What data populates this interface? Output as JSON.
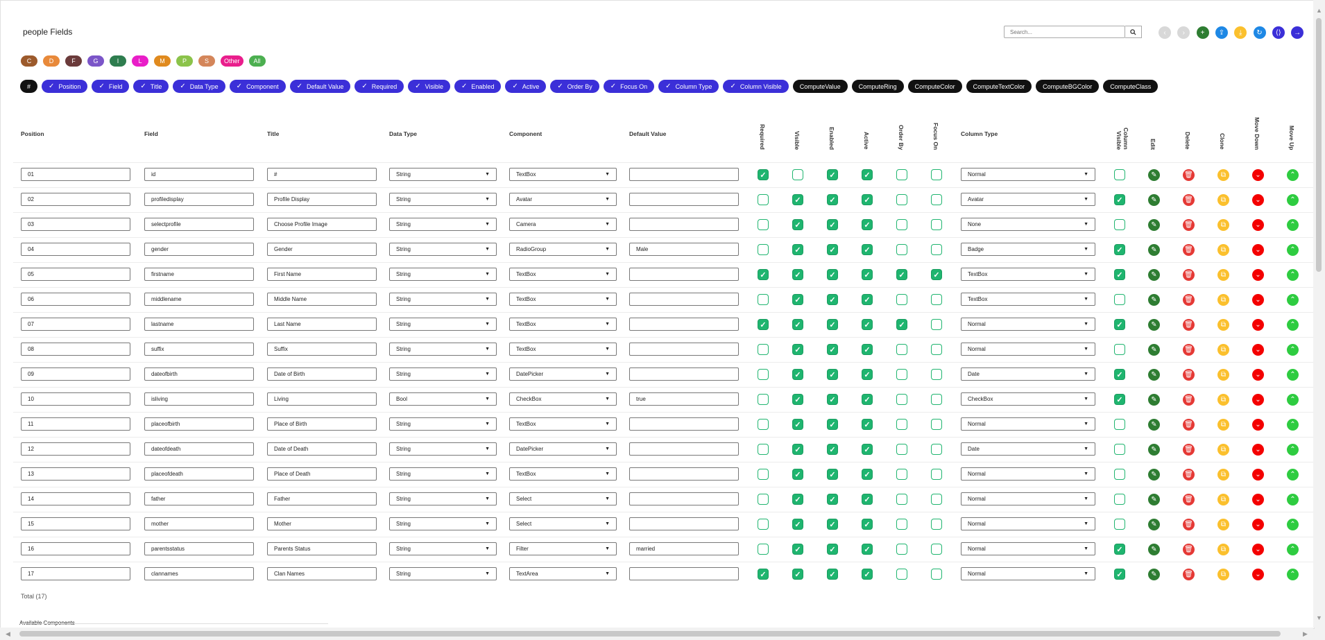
{
  "page": {
    "title": "people Fields"
  },
  "search": {
    "placeholder": "Search..."
  },
  "toolbar": [
    {
      "name": "prev-icon",
      "glyph": "‹",
      "color": "#d8d8d8"
    },
    {
      "name": "next-icon",
      "glyph": "›",
      "color": "#d8d8d8"
    },
    {
      "name": "add-icon",
      "glyph": "+",
      "color": "#2e7d32"
    },
    {
      "name": "upload-icon",
      "glyph": "⇪",
      "color": "#1e88e5"
    },
    {
      "name": "download-icon",
      "glyph": "⤓",
      "color": "#fbc02d"
    },
    {
      "name": "refresh-icon",
      "glyph": "↻",
      "color": "#1e88e5"
    },
    {
      "name": "code-icon",
      "glyph": "⟨⟩",
      "color": "#3b2fd8"
    },
    {
      "name": "exit-icon",
      "glyph": "→",
      "color": "#3b2fd8"
    }
  ],
  "letters": [
    {
      "label": "C",
      "color": "#9c5a2c"
    },
    {
      "label": "D",
      "color": "#e8893a"
    },
    {
      "label": "F",
      "color": "#6b3b3b"
    },
    {
      "label": "G",
      "color": "#7b55c8"
    },
    {
      "label": "I",
      "color": "#2e7d4f"
    },
    {
      "label": "L",
      "color": "#e91ec8"
    },
    {
      "label": "M",
      "color": "#e08a1e"
    },
    {
      "label": "P",
      "color": "#8bc34a"
    },
    {
      "label": "S",
      "color": "#d4865a"
    },
    {
      "label": "Other",
      "color": "#e91e8c"
    },
    {
      "label": "All",
      "color": "#4caf50"
    }
  ],
  "column_toggles": [
    {
      "label": "#",
      "on": false
    },
    {
      "label": "Position",
      "on": true
    },
    {
      "label": "Field",
      "on": true
    },
    {
      "label": "Title",
      "on": true
    },
    {
      "label": "Data Type",
      "on": true
    },
    {
      "label": "Component",
      "on": true
    },
    {
      "label": "Default Value",
      "on": true
    },
    {
      "label": "Required",
      "on": true
    },
    {
      "label": "Visible",
      "on": true
    },
    {
      "label": "Enabled",
      "on": true
    },
    {
      "label": "Active",
      "on": true
    },
    {
      "label": "Order By",
      "on": true
    },
    {
      "label": "Focus On",
      "on": true
    },
    {
      "label": "Column Type",
      "on": true
    },
    {
      "label": "Column Visible",
      "on": true
    },
    {
      "label": "ComputeValue",
      "on": false
    },
    {
      "label": "ComputeRing",
      "on": false
    },
    {
      "label": "ComputeColor",
      "on": false
    },
    {
      "label": "ComputeTextColor",
      "on": false
    },
    {
      "label": "ComputeBGColor",
      "on": false
    },
    {
      "label": "ComputeClass",
      "on": false
    }
  ],
  "table": {
    "headers": {
      "position": "Position",
      "field": "Field",
      "title": "Title",
      "data_type": "Data Type",
      "component": "Component",
      "default_value": "Default Value",
      "required": "Required",
      "visible": "Visible",
      "enabled": "Enabled",
      "active": "Active",
      "order_by": "Order By",
      "focus_on": "Focus On",
      "column_type": "Column Type",
      "column_visible": "Column Visible",
      "edit": "Edit",
      "delete": "Delete",
      "clone": "Clone",
      "move_down": "Move Down",
      "move_up": "Move Up"
    },
    "rows": [
      {
        "position": "01",
        "field": "id",
        "title": "#",
        "data_type": "String",
        "component": "TextBox",
        "default_value": "",
        "required": true,
        "visible": false,
        "enabled": true,
        "active": true,
        "order_by": false,
        "focus_on": false,
        "column_type": "Normal",
        "column_visible": false
      },
      {
        "position": "02",
        "field": "profiledisplay",
        "title": "Profile Display",
        "data_type": "String",
        "component": "Avatar",
        "default_value": "",
        "required": false,
        "visible": true,
        "enabled": true,
        "active": true,
        "order_by": false,
        "focus_on": false,
        "column_type": "Avatar",
        "column_visible": true
      },
      {
        "position": "03",
        "field": "selectprofile",
        "title": "Choose Profile Image",
        "data_type": "String",
        "component": "Camera",
        "default_value": "",
        "required": false,
        "visible": true,
        "enabled": true,
        "active": true,
        "order_by": false,
        "focus_on": false,
        "column_type": "None",
        "column_visible": false
      },
      {
        "position": "04",
        "field": "gender",
        "title": "Gender",
        "data_type": "String",
        "component": "RadioGroup",
        "default_value": "Male",
        "required": false,
        "visible": true,
        "enabled": true,
        "active": true,
        "order_by": false,
        "focus_on": false,
        "column_type": "Badge",
        "column_visible": true
      },
      {
        "position": "05",
        "field": "firstname",
        "title": "First Name",
        "data_type": "String",
        "component": "TextBox",
        "default_value": "",
        "required": true,
        "visible": true,
        "enabled": true,
        "active": true,
        "order_by": true,
        "focus_on": true,
        "column_type": "TextBox",
        "column_visible": true
      },
      {
        "position": "06",
        "field": "middlename",
        "title": "Middle Name",
        "data_type": "String",
        "component": "TextBox",
        "default_value": "",
        "required": false,
        "visible": true,
        "enabled": true,
        "active": true,
        "order_by": false,
        "focus_on": false,
        "column_type": "TextBox",
        "column_visible": false
      },
      {
        "position": "07",
        "field": "lastname",
        "title": "Last Name",
        "data_type": "String",
        "component": "TextBox",
        "default_value": "",
        "required": true,
        "visible": true,
        "enabled": true,
        "active": true,
        "order_by": true,
        "focus_on": false,
        "column_type": "Normal",
        "column_visible": true
      },
      {
        "position": "08",
        "field": "suffix",
        "title": "Suffix",
        "data_type": "String",
        "component": "TextBox",
        "default_value": "",
        "required": false,
        "visible": true,
        "enabled": true,
        "active": true,
        "order_by": false,
        "focus_on": false,
        "column_type": "Normal",
        "column_visible": false
      },
      {
        "position": "09",
        "field": "dateofbirth",
        "title": "Date of Birth",
        "data_type": "String",
        "component": "DatePicker",
        "default_value": "",
        "required": false,
        "visible": true,
        "enabled": true,
        "active": true,
        "order_by": false,
        "focus_on": false,
        "column_type": "Date",
        "column_visible": true
      },
      {
        "position": "10",
        "field": "isliving",
        "title": "Living",
        "data_type": "Bool",
        "component": "CheckBox",
        "default_value": "true",
        "required": false,
        "visible": true,
        "enabled": true,
        "active": true,
        "order_by": false,
        "focus_on": false,
        "column_type": "CheckBox",
        "column_visible": true
      },
      {
        "position": "11",
        "field": "placeofbirth",
        "title": "Place of Birth",
        "data_type": "String",
        "component": "TextBox",
        "default_value": "",
        "required": false,
        "visible": true,
        "enabled": true,
        "active": true,
        "order_by": false,
        "focus_on": false,
        "column_type": "Normal",
        "column_visible": false
      },
      {
        "position": "12",
        "field": "dateofdeath",
        "title": "Date of Death",
        "data_type": "String",
        "component": "DatePicker",
        "default_value": "",
        "required": false,
        "visible": true,
        "enabled": true,
        "active": true,
        "order_by": false,
        "focus_on": false,
        "column_type": "Date",
        "column_visible": false
      },
      {
        "position": "13",
        "field": "placeofdeath",
        "title": "Place of Death",
        "data_type": "String",
        "component": "TextBox",
        "default_value": "",
        "required": false,
        "visible": true,
        "enabled": true,
        "active": true,
        "order_by": false,
        "focus_on": false,
        "column_type": "Normal",
        "column_visible": false
      },
      {
        "position": "14",
        "field": "father",
        "title": "Father",
        "data_type": "String",
        "component": "Select",
        "default_value": "",
        "required": false,
        "visible": true,
        "enabled": true,
        "active": true,
        "order_by": false,
        "focus_on": false,
        "column_type": "Normal",
        "column_visible": false
      },
      {
        "position": "15",
        "field": "mother",
        "title": "Mother",
        "data_type": "String",
        "component": "Select",
        "default_value": "",
        "required": false,
        "visible": true,
        "enabled": true,
        "active": true,
        "order_by": false,
        "focus_on": false,
        "column_type": "Normal",
        "column_visible": false
      },
      {
        "position": "16",
        "field": "parentsstatus",
        "title": "Parents Status",
        "data_type": "String",
        "component": "Filter",
        "default_value": "married",
        "required": false,
        "visible": true,
        "enabled": true,
        "active": true,
        "order_by": false,
        "focus_on": false,
        "column_type": "Normal",
        "column_visible": true
      },
      {
        "position": "17",
        "field": "clannames",
        "title": "Clan Names",
        "data_type": "String",
        "component": "TextArea",
        "default_value": "",
        "required": true,
        "visible": true,
        "enabled": true,
        "active": true,
        "order_by": false,
        "focus_on": false,
        "column_type": "Normal",
        "column_visible": true
      }
    ],
    "total": "Total (17)"
  },
  "actions": {
    "edit": {
      "icon": "pencil-icon",
      "glyph": "✎",
      "color": "#2e7d32"
    },
    "delete": {
      "icon": "trash-icon",
      "glyph": "🗑",
      "color": "#e53935"
    },
    "clone": {
      "icon": "clone-icon",
      "glyph": "⧉",
      "color": "#fbc02d"
    },
    "move_down": {
      "icon": "chevron-down-icon",
      "glyph": "⌄",
      "color": "#f40000"
    },
    "move_up": {
      "icon": "chevron-up-icon",
      "glyph": "⌃",
      "color": "#2ecc40"
    }
  },
  "footer": {
    "available_components": "Available Components"
  }
}
